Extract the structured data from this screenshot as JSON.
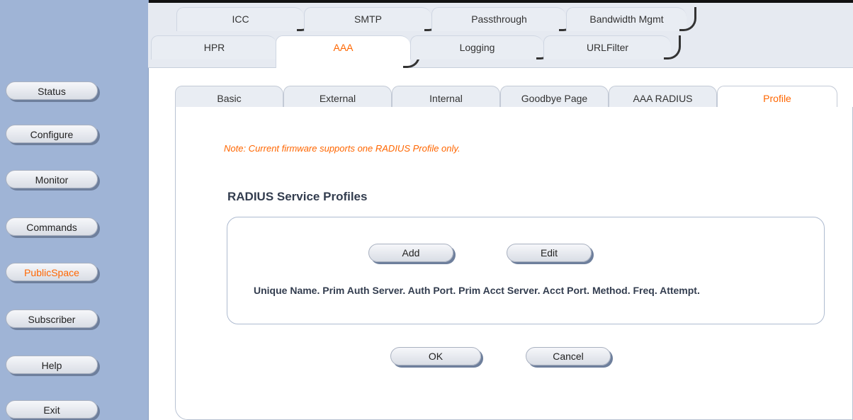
{
  "sidebar": {
    "items": [
      {
        "label": "Status"
      },
      {
        "label": "Configure"
      },
      {
        "label": "Monitor"
      },
      {
        "label": "Commands"
      },
      {
        "label": "PublicSpace"
      },
      {
        "label": "Subscriber"
      },
      {
        "label": "Help"
      },
      {
        "label": "Exit"
      }
    ],
    "active": "PublicSpace"
  },
  "tabs": {
    "row1": [
      {
        "label": "ICC"
      },
      {
        "label": "SMTP"
      },
      {
        "label": "Passthrough"
      },
      {
        "label": "Bandwidth Mgmt"
      }
    ],
    "row2": [
      {
        "label": "HPR"
      },
      {
        "label": "AAA"
      },
      {
        "label": "Logging"
      },
      {
        "label": "URLFilter"
      }
    ],
    "active_row2": "AAA"
  },
  "subtabs": {
    "items": [
      {
        "label": "Basic"
      },
      {
        "label": "External"
      },
      {
        "label": "Internal"
      },
      {
        "label": "Goodbye Page"
      },
      {
        "label": "AAA RADIUS"
      },
      {
        "label": "Profile"
      }
    ],
    "active": "Profile"
  },
  "main": {
    "note": "Note: Current firmware supports one RADIUS Profile only.",
    "section_title": "RADIUS Service Profiles",
    "add_label": "Add",
    "edit_label": "Edit",
    "columns_text": "Unique Name. Prim Auth Server. Auth Port. Prim Acct Server.  Acct Port. Method. Freq. Attempt.",
    "ok_label": "OK",
    "cancel_label": "Cancel"
  },
  "colors": {
    "sidebar_bg": "#9fb4d6",
    "active_text": "#ff6600",
    "note_text": "#ff6600"
  }
}
